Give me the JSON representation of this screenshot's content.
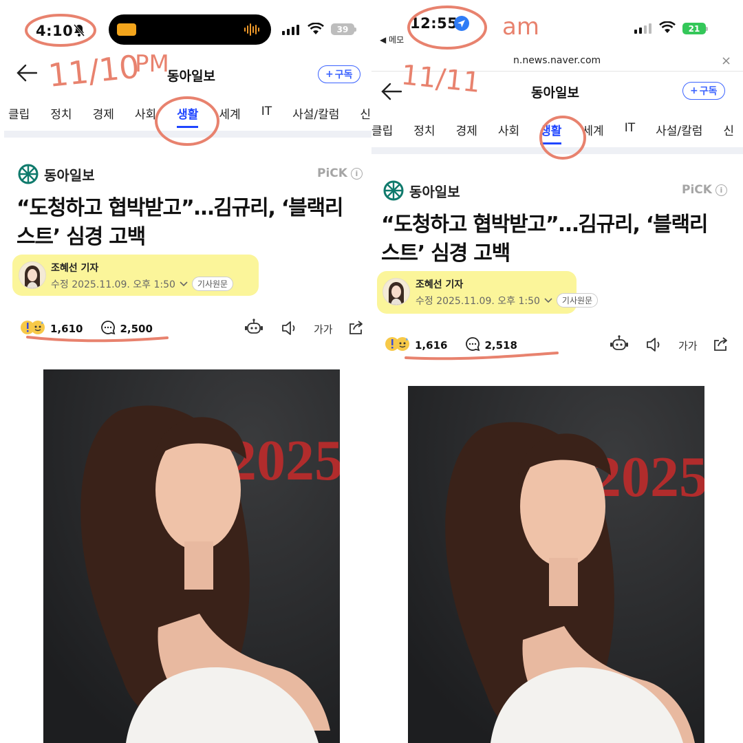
{
  "colors": {
    "accent": "#1f45ff",
    "highlight": "#fbf59a",
    "annotation": "#e8826e"
  },
  "left": {
    "status": {
      "time": "4:10",
      "battery": "39"
    },
    "header": {
      "title": "동아일보",
      "subscribe_label": "구독"
    },
    "tabs": [
      {
        "label": "클립",
        "active": false
      },
      {
        "label": "정치",
        "active": false
      },
      {
        "label": "경제",
        "active": false
      },
      {
        "label": "사회",
        "active": false
      },
      {
        "label": "생활",
        "active": true
      },
      {
        "label": "세계",
        "active": false
      },
      {
        "label": "IT",
        "active": false
      },
      {
        "label": "사설/칼럼",
        "active": false
      },
      {
        "label": "신",
        "active": false
      }
    ],
    "article": {
      "publisher": "동아일보",
      "pick_label": "PiCK",
      "headline_line1": "“도청하고 협박받고”…김규리, ‘블랙리",
      "headline_line2": "스트’ 심경 고백",
      "reporter": "조혜선 기자",
      "modified": "수정 2025.11.09. 오후 1:50",
      "original_label": "기사원문",
      "reaction_count": "1,610",
      "comment_count": "2,500",
      "font_label": "가가",
      "backdrop_text": "2025"
    },
    "annotations": {
      "date": "11/10",
      "period": "PM"
    }
  },
  "right": {
    "status": {
      "time": "12:55",
      "back_app": "◀ 메모",
      "battery": "21",
      "url": "n.news.naver.com"
    },
    "header": {
      "title": "동아일보",
      "subscribe_label": "구독"
    },
    "tabs": [
      {
        "label": "클립",
        "active": false
      },
      {
        "label": "정치",
        "active": false
      },
      {
        "label": "경제",
        "active": false
      },
      {
        "label": "사회",
        "active": false
      },
      {
        "label": "생활",
        "active": true
      },
      {
        "label": "세계",
        "active": false
      },
      {
        "label": "IT",
        "active": false
      },
      {
        "label": "사설/칼럼",
        "active": false
      },
      {
        "label": "신",
        "active": false
      }
    ],
    "article": {
      "publisher": "동아일보",
      "pick_label": "PiCK",
      "headline_line1": "“도청하고 협박받고”…김규리, ‘블랙리",
      "headline_line2": "스트’ 심경 고백",
      "reporter": "조혜선 기자",
      "modified": "수정 2025.11.09. 오후 1:50",
      "original_label": "기사원문",
      "reaction_count": "1,616",
      "comment_count": "2,518",
      "font_label": "가가",
      "backdrop_text": "2025"
    },
    "annotations": {
      "date": "11/11",
      "period": "am"
    }
  }
}
